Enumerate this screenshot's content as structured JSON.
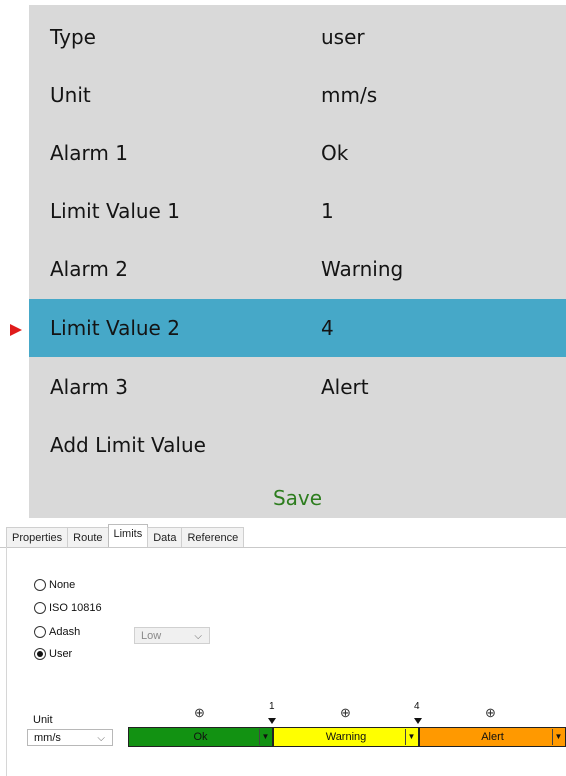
{
  "device": {
    "rows": [
      {
        "label": "Type",
        "value": "user"
      },
      {
        "label": "Unit",
        "value": "mm/s"
      },
      {
        "label": "Alarm 1",
        "value": "Ok"
      },
      {
        "label": "Limit Value 1",
        "value": "1"
      },
      {
        "label": "Alarm 2",
        "value": "Warning"
      },
      {
        "label": "Limit Value 2",
        "value": "4"
      },
      {
        "label": "Alarm 3",
        "value": "Alert"
      },
      {
        "label": "Add Limit Value",
        "value": ""
      }
    ],
    "save_label": "Save",
    "colors": {
      "panel": "#d9d9d9",
      "selected_row": "#46a8c8",
      "pointer": "#e01b1b",
      "save_text": "#2d7d1e"
    }
  },
  "dialog": {
    "tabs": [
      "Properties",
      "Route",
      "Limits",
      "Data",
      "Reference"
    ],
    "active_tab": "Limits",
    "radios": [
      {
        "label": "None",
        "checked": false
      },
      {
        "label": "ISO 10816",
        "checked": false
      },
      {
        "label": "Adash",
        "checked": false
      },
      {
        "label": "User",
        "checked": true
      }
    ],
    "adash_combo": {
      "value": "Low",
      "enabled": false
    },
    "unit": {
      "label": "Unit",
      "value": "mm/s"
    },
    "limits": [
      "1",
      "4"
    ],
    "add_symbol": "⊕",
    "alarm_segments": [
      {
        "label": "Ok",
        "color": "#129212"
      },
      {
        "label": "Warning",
        "color": "#ffff00"
      },
      {
        "label": "Alert",
        "color": "#ff9900"
      }
    ]
  }
}
